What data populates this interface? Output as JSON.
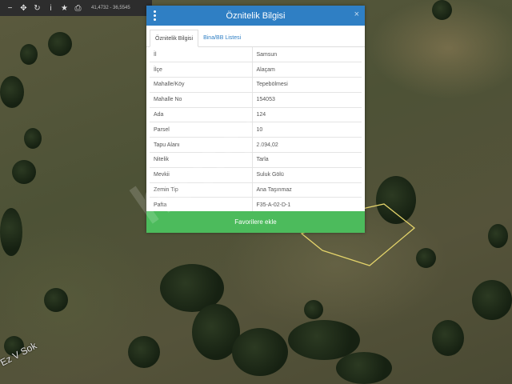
{
  "toolbar": {
    "coords": "41,4732 - 36,5545",
    "buttons": [
      {
        "name": "minus-icon",
        "glyph": "−"
      },
      {
        "name": "move-icon",
        "glyph": "✥"
      },
      {
        "name": "refresh-icon",
        "glyph": "↻"
      },
      {
        "name": "info-icon",
        "glyph": "i"
      },
      {
        "name": "star-icon",
        "glyph": "★"
      },
      {
        "name": "print-icon",
        "glyph": "⎙"
      }
    ]
  },
  "watermark": "hepsi",
  "map": {
    "road_label": "Ez V Sok"
  },
  "dialog": {
    "title": "Öznitelik Bilgisi",
    "close_glyph": "×",
    "tabs": [
      {
        "label": "Öznitelik Bilgisi",
        "active": true
      },
      {
        "label": "Bina/BB Listesi",
        "active": false
      }
    ],
    "rows": [
      {
        "key": "İl",
        "value": "Samsun"
      },
      {
        "key": "İlçe",
        "value": "Alaçam"
      },
      {
        "key": "Mahalle/Köy",
        "value": "Tepebölmesi"
      },
      {
        "key": "Mahalle No",
        "value": "154053"
      },
      {
        "key": "Ada",
        "value": "124"
      },
      {
        "key": "Parsel",
        "value": "10"
      },
      {
        "key": "Tapu Alanı",
        "value": "2.094,02"
      },
      {
        "key": "Nitelik",
        "value": "Tarla"
      },
      {
        "key": "Mevkii",
        "value": "Suluk Gölü"
      },
      {
        "key": "Zemin Tip",
        "value": "Ana Taşınmaz"
      },
      {
        "key": "Pafta",
        "value": "F35-A-02-D-1"
      }
    ],
    "favorite_button": "Favorilere ekle"
  },
  "colors": {
    "header": "#2f7fc4",
    "button": "#4cbb5c",
    "parcel_outline": "#e3d36a"
  }
}
